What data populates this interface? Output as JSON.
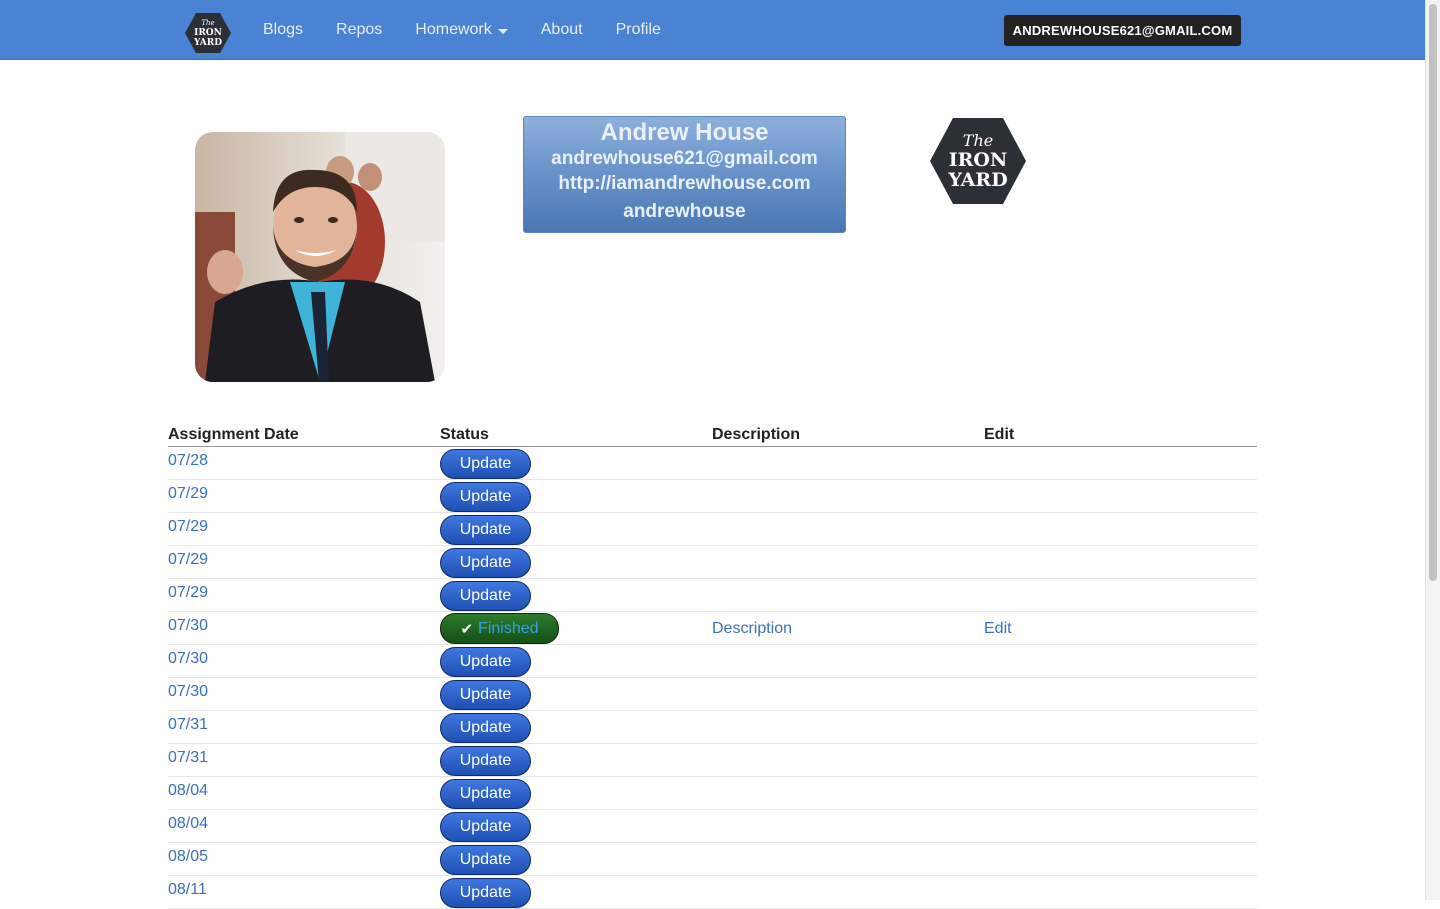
{
  "navbar": {
    "logo_text": [
      "The",
      "IRON",
      "YARD"
    ],
    "links": [
      {
        "label": "Blogs"
      },
      {
        "label": "Repos"
      },
      {
        "label": "Homework",
        "dropdown": true
      },
      {
        "label": "About"
      },
      {
        "label": "Profile"
      }
    ],
    "user_email": "ANDREWHOUSE621@GMAIL.COM"
  },
  "profile": {
    "name": "Andrew House",
    "email": "andrewhouse621@gmail.com",
    "website": "http://iamandrewhouse.com",
    "username": "andrewhouse"
  },
  "table": {
    "headers": [
      "Assignment Date",
      "Status",
      "Description",
      "Edit"
    ],
    "rows": [
      {
        "date": "07/28",
        "status": "Update"
      },
      {
        "date": "07/29",
        "status": "Update"
      },
      {
        "date": "07/29",
        "status": "Update"
      },
      {
        "date": "07/29",
        "status": "Update"
      },
      {
        "date": "07/29",
        "status": "Update"
      },
      {
        "date": "07/30",
        "status": "Finished",
        "description": "Description",
        "edit": "Edit"
      },
      {
        "date": "07/30",
        "status": "Update"
      },
      {
        "date": "07/30",
        "status": "Update"
      },
      {
        "date": "07/31",
        "status": "Update"
      },
      {
        "date": "07/31",
        "status": "Update"
      },
      {
        "date": "08/04",
        "status": "Update"
      },
      {
        "date": "08/04",
        "status": "Update"
      },
      {
        "date": "08/05",
        "status": "Update"
      },
      {
        "date": "08/11",
        "status": "Update"
      }
    ]
  },
  "colors": {
    "navbar": "#4a82d4",
    "link": "#3a6fbf",
    "update_button": "#2a5fcf",
    "finished_button": "#1f6a1f"
  },
  "icons": [
    "iron-yard-logo",
    "check-icon",
    "caret-down-icon"
  ]
}
